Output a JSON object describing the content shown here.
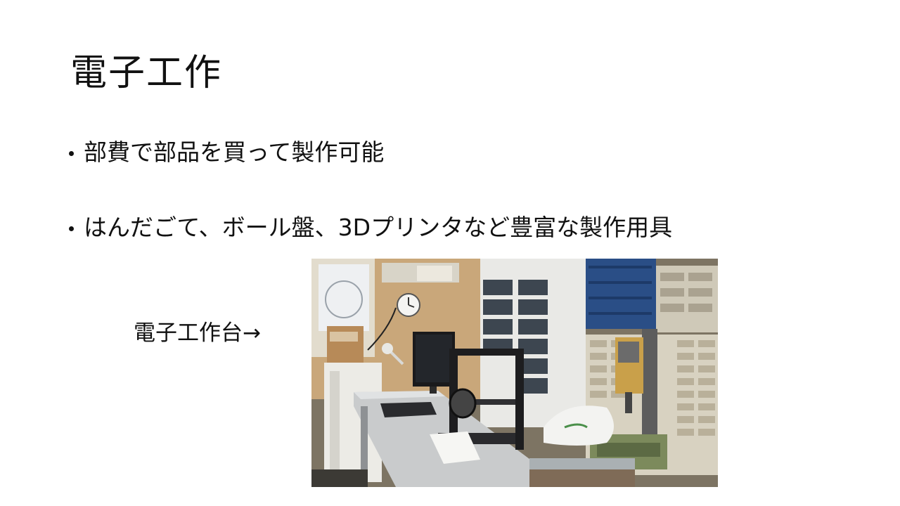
{
  "slide": {
    "title": "電子工作",
    "bullets": [
      "部費で部品を買って製作可能",
      "はんだごて、ボール盤、3Dプリンタなど豊富な製作用具"
    ],
    "photo_caption": "電子工作台→"
  },
  "colors": {
    "background": "#ffffff",
    "text": "#111111"
  }
}
